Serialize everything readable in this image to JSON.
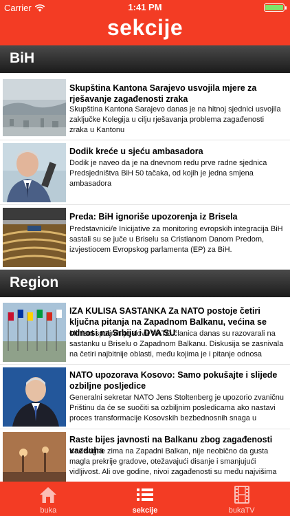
{
  "status_bar": {
    "carrier": "Carrier",
    "time": "1:41 PM",
    "battery_level": 1.0
  },
  "header": {
    "title": "sekcije"
  },
  "sections": [
    {
      "title": "BiH"
    },
    {
      "title": "Region"
    }
  ],
  "articles": [
    {
      "title": "Skupština Kantona Sarajevo usvojila mjere za rješavanje zagađenosti zraka",
      "desc": "Skupština Kantona Sarajevo danas je na hitnoj sjednici usvojila zaključke Kolegija u cilju rješavanja problema zagađenosti zraka u Kantonu"
    },
    {
      "title": "Dodik kreće u sjeću ambasadora",
      "desc": "Dodik je naveo da je na dnevnom redu prve radne sjednica Predsjedništva BiH 50 tačaka, od kojih je jedna smjena ambasadora"
    },
    {
      "title": "Preda: BiH ignoriše upozorenja iz Brisela",
      "desc": "Predstavnici/e Inicijative za monitoring evropskih integracija BiH sastali su se juče u Briselu sa Cristianom Danom Predom, izvjestiocem Evropskog parlamenta (EP) za BiH."
    },
    {
      "title": "IZA KULISA SASTANKA Za NATO postoje četiri ključna pitanja na Zapadnom Balkanu, većina se odnosi na Srbiju i DVA SU",
      "desc": "Ministri spoljnih poslova NATO članica danas su razovarali na sastanku u Briselu o Zapadnom Balkanu. Diskusija se zasnivala na četiri najbitnije oblasti, među kojima je i pitanje odnosa između Srbije"
    },
    {
      "title": "NATO upozorava Kosovo: Samo pokušajte i slijede ozbiljne posljedice",
      "desc": "Generalni sekretar NATO Jens Stoltenberg je upozorio zvaničnu Prištinu da će se suočiti sa ozbiljnim posledicama ako nastavi proces transformacije Kosovskih bezbednosnih snaga u kosovsku Vojsku."
    },
    {
      "title": "Raste bijes javnosti na Balkanu zbog zagađenosti vazduha",
      "desc": "Kad stigne zima na Zapadni Balkan, nije neobično da gusta magla prekrije gradove, otežavajući disanje i smanjujući vidljivost. Ali ove godine, nivoi zagađenosti su među najvišima na svijetu, zbog čega"
    }
  ],
  "tabs": [
    {
      "label": "buka",
      "icon": "home-icon"
    },
    {
      "label": "sekcije",
      "icon": "list-icon"
    },
    {
      "label": "bukaTV",
      "icon": "film-icon"
    }
  ],
  "colors": {
    "brand": "#f33c24",
    "section_bar": "#2a2a2a"
  }
}
